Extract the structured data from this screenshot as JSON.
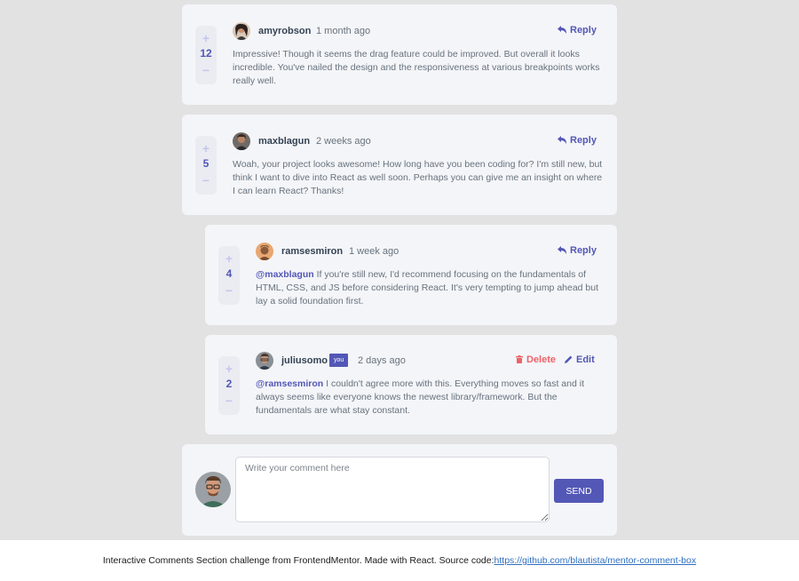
{
  "comments": [
    {
      "score": "12",
      "username": "amyrobson",
      "created": "1 month ago",
      "reply_label": "Reply",
      "content": "Impressive! Though it seems the drag feature could be improved. But overall it looks incredible. You've nailed the design and the responsiveness at various breakpoints works really well."
    },
    {
      "score": "5",
      "username": "maxblagun",
      "created": "2 weeks ago",
      "reply_label": "Reply",
      "content": "Woah, your project looks awesome! How long have you been coding for? I'm still new, but think I want to dive into React as well soon. Perhaps you can give me an insight on where I can learn React? Thanks!"
    }
  ],
  "replies": [
    {
      "score": "4",
      "username": "ramsesmiron",
      "created": "1 week ago",
      "reply_label": "Reply",
      "replying_to": "@maxblagun",
      "content": " If you're still new, I'd recommend focusing on the fundamentals of HTML, CSS, and JS before considering React. It's very tempting to jump ahead but lay a solid foundation first."
    },
    {
      "score": "2",
      "username": "juliusomo",
      "you_badge": "you",
      "created": "2 days ago",
      "delete_label": "Delete",
      "edit_label": "Edit",
      "replying_to": "@ramsesmiron",
      "content": " I couldn't agree more with this. Everything moves so fast and it always seems like everyone knows the newest library/framework. But the fundamentals are what stay constant."
    }
  ],
  "vote": {
    "plus": "+",
    "minus": "−"
  },
  "composer": {
    "placeholder": "Write your comment here",
    "send_label": "SEND"
  },
  "footer": {
    "text": "Interactive Comments Section challenge from FrontendMentor. Made with React. Source code:",
    "link": "https://github.com/blautista/mentor-comment-box"
  },
  "colors": {
    "accent": "#5357b6",
    "danger": "#ed6368",
    "card": "#f4f5f8",
    "background": "#e2e2e2"
  },
  "icons": {
    "reply": "reply-arrow-icon",
    "delete": "trash-icon",
    "edit": "pencil-icon"
  }
}
